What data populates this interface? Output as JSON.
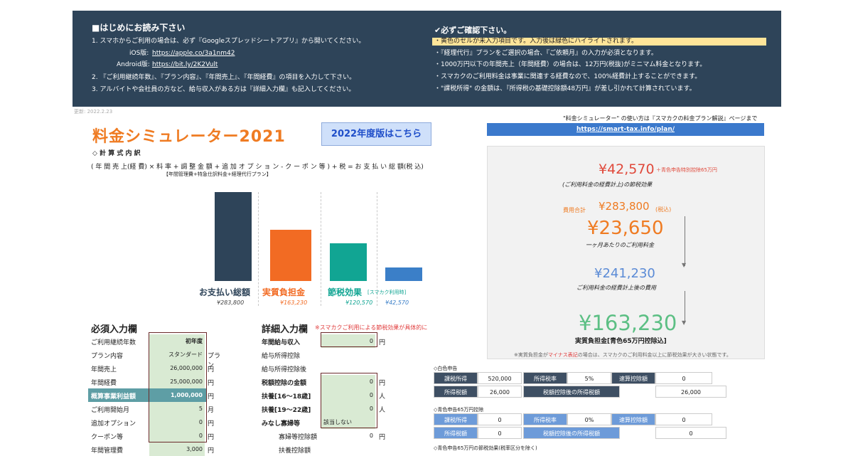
{
  "header": {
    "left_title": "■はじめにお読み下さい",
    "left_lines": [
      "1. スマホからご利用の場合は、必ず『Googleスプレッドシートアプリ』から開いてください。",
      "2. 『ご利用継続年数』、『プラン内容』、『年間売上』、『年間経費』の項目を入力して下さい。",
      "3. アルバイトや会社員の方など、給与収入がある方は『詳細入力欄』も記入してください。"
    ],
    "ios_label": "iOS版:",
    "ios_link": "https://apple.co/3a1nm42",
    "android_label": "Android版:",
    "android_link": "https://bit.ly/2K2Vult",
    "right_title": "✔必ずご確認下さい。",
    "right_lines": [
      "・黄色のセルが未入力項目です。入力後は緑色にハイライトされます。",
      "・『経理代行』プランをご選択の場合、『ご依頼月』の入力が必須となります。",
      "・1000万円以下の年間売上（年間経費）の場合は、12万円(税抜)がミニマム料金となります。",
      "・スマカクのご利用料金は事業に関連する経費なので、100%経費計上することができます。",
      "・\"課税所得\" の金額は、『所得税の基礎控除額48万円』が差し引かれて計算されています。"
    ]
  },
  "updated": "更新: 2022.2.23",
  "title": "料金シミュレーター2021",
  "btn_2022": "2022年度版はこちら",
  "formula_heading": "◇ 計 算 式 内 訳",
  "formula": "( 年 間 売 上(経 費) × 料 率 + 調 整 金 額 + 追 加 オ プ シ ョ ン - ク ー ポ ン 等 ) + 税 = お 支 払 い 総 額(税 込)",
  "formula_sub": "【年間管理費+特急仕訳料金+経理代行プラン】",
  "chart_data": {
    "type": "bar",
    "categories": [
      "お支払い総額",
      "実質負担金",
      "節税効果",
      "スマカク利用時"
    ],
    "values": [
      283800,
      163230,
      120570,
      42570
    ],
    "value_labels": [
      "¥283,800",
      "¥163,230",
      "¥120,570",
      "¥42,570"
    ],
    "colors": [
      "#2e4459",
      "#f26b23",
      "#11a593",
      "#3b7fc8"
    ],
    "extra_label": "[スマカク利用時]"
  },
  "required": {
    "title": "必須入力欄",
    "rows": [
      {
        "label": "ご利用継続年数",
        "value": "初年度",
        "unit": ""
      },
      {
        "label": "プラン内容",
        "value": "スタンダード",
        "unit": "プラン"
      },
      {
        "label": "年間売上",
        "value": "26,000,000",
        "unit": "円"
      },
      {
        "label": "年間経費",
        "value": "25,000,000",
        "unit": "円"
      },
      {
        "label": "概算事業利益額",
        "value": "1,000,000",
        "unit": "円"
      },
      {
        "label": "ご利用開始月",
        "value": "5",
        "unit": "月"
      },
      {
        "label": "追加オプション",
        "value": "0",
        "unit": "円"
      },
      {
        "label": "クーポン等",
        "value": "0",
        "unit": "円"
      },
      {
        "label": "年間管理費",
        "value": "3,000",
        "unit": "円"
      }
    ]
  },
  "detail": {
    "title": "詳細入力欄",
    "note": "※スマカクご利用による節税効果が具体的に",
    "rows": [
      {
        "label": "年間給与収入",
        "value": "0",
        "unit": "円"
      },
      {
        "label": "給与所得控除",
        "value": "",
        "unit": ""
      },
      {
        "label": "給与所得控除後",
        "value": "",
        "unit": ""
      },
      {
        "label": "税額控除の金額",
        "value": "0",
        "unit": "円"
      },
      {
        "label": "扶養[16〜18歳]",
        "value": "0",
        "unit": "人"
      },
      {
        "label": "扶養[19〜22歳]",
        "value": "0",
        "unit": "人"
      },
      {
        "label": "みなし寡婦等",
        "value": "該当しない",
        "unit": ""
      },
      {
        "label": "寡婦等控除額",
        "value": "0",
        "unit": "円"
      },
      {
        "label": "扶養控除額",
        "value": "",
        "unit": ""
      }
    ]
  },
  "right": {
    "intro": "\"料金シミュレーター\" の使い方は『スマカクの料金プラン解説』ページまで",
    "link": "https://smart-tax.info/plan/",
    "v1": "¥42,570",
    "v1_note": "＋青色申告特別控除65万円",
    "v1_cap": "(ご利用料金の経費計上)の節税効果",
    "cost_total_label": "費用合計",
    "cost_total": "¥283,800",
    "tax_incl": "(税込)",
    "monthly": "¥23,650",
    "monthly_cap": "一ヶ月あたりのご利用料金",
    "after": "¥241,230",
    "after_cap": "ご利用料金の経費計上後の費用",
    "real": "¥163,230",
    "real_cap": "実質負担金[青色65万円控除込]",
    "footnote": "※実質負担金が",
    "footnote_red": "マイナス表記",
    "footnote_end": "の場合は、スマカクのご利用料金以上に節税効果が大きい状態です。"
  },
  "white_table": {
    "title": "◇白色申告",
    "r1": [
      "課税所得",
      "520,000",
      "所得税率",
      "5%",
      "速算控除額",
      "0"
    ],
    "r2": [
      "所得税額",
      "26,000",
      "税額控除後の所得税額",
      "26,000"
    ]
  },
  "blue_table": {
    "title": "◇青色申告65万円控除",
    "r1": [
      "課税所得",
      "0",
      "所得税率",
      "0%",
      "速算控除額",
      "0"
    ],
    "r2": [
      "所得税額",
      "0",
      "税額控除後の所得税額",
      "0"
    ]
  },
  "bottom_title": "◇青色申告65万円の節税効果(税率区分を除く)"
}
